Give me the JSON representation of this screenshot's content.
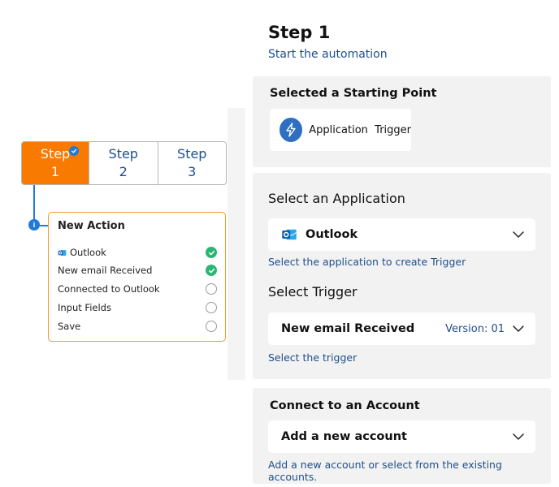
{
  "flow": {
    "steps": [
      {
        "label": "Step",
        "num": "1"
      },
      {
        "label": "Step",
        "num": "2"
      },
      {
        "label": "Step",
        "num": "3"
      }
    ],
    "info_marker": "i",
    "card": {
      "title": "New Action",
      "rows": [
        {
          "label": "Outlook",
          "status": "done"
        },
        {
          "label": "New email Received",
          "status": "done"
        },
        {
          "label": "Connected to Outlook",
          "status": "pending"
        },
        {
          "label": "Input Fields",
          "status": "pending"
        },
        {
          "label": "Save",
          "status": "pending"
        }
      ]
    }
  },
  "panel": {
    "heading": "Step 1",
    "subheading": "Start the automation",
    "starting_point": {
      "title": "Selected a Starting Point",
      "chip_label": "Application  Trigger"
    },
    "application": {
      "title": "Select an Application",
      "value": "Outlook",
      "helper": "Select the application to create Trigger"
    },
    "trigger": {
      "title": "Select Trigger",
      "value": "New email Received",
      "version": "Version: 01",
      "helper": "Select the trigger"
    },
    "account": {
      "title": "Connect to an Account",
      "value": "Add a new account",
      "helper": "Add a new account or select from the existing accounts."
    }
  },
  "colors": {
    "accent_orange": "#f97a00",
    "brand_blue": "#1f7ad8",
    "text_blue": "#1f4e8c",
    "success_green": "#2bb673"
  },
  "icons": [
    "check-badge-icon",
    "info-icon",
    "outlook-icon",
    "check-circle-icon",
    "empty-circle-icon",
    "lightning-bolt-icon",
    "chevron-down-icon"
  ]
}
